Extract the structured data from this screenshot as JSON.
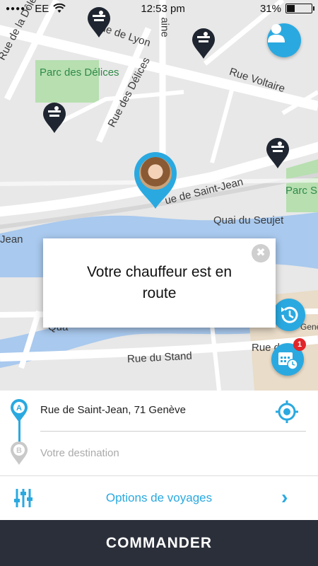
{
  "status_bar": {
    "carrier": "EE",
    "time": "12:53 pm",
    "battery": "31%"
  },
  "map": {
    "streets": [
      "Rue de la Dôle",
      "Rue de Lyon",
      "Rue Voltaire",
      "Rue des Délices",
      "aine",
      "ue de Saint-Jean",
      "Quai du Seujet",
      "Jean",
      "Rue du Stand",
      "Rue du",
      "Qua"
    ],
    "parks": [
      "Parc des Délices",
      "Parc S"
    ],
    "other_labels": [
      "Genè"
    ]
  },
  "popup": {
    "message": "Votre chauffeur est en route",
    "close_symbol": "✖"
  },
  "schedule_badge": "1",
  "trip": {
    "pickup_marker": "A",
    "pickup_address": "Rue de Saint-Jean, 71 Genève",
    "destination_marker": "B",
    "destination_placeholder": "Votre destination"
  },
  "options": {
    "label": "Options de voyages",
    "chevron": "›"
  },
  "cta": {
    "label": "COMMANDER"
  },
  "colors": {
    "accent": "#2aa9e0",
    "dark": "#2b2f3a",
    "badge": "#e0262b"
  },
  "icons": [
    "user-icon",
    "history-icon",
    "calendar-icon",
    "target-icon",
    "sliders-icon",
    "taxi-pin-icon",
    "driver-pin-icon"
  ]
}
